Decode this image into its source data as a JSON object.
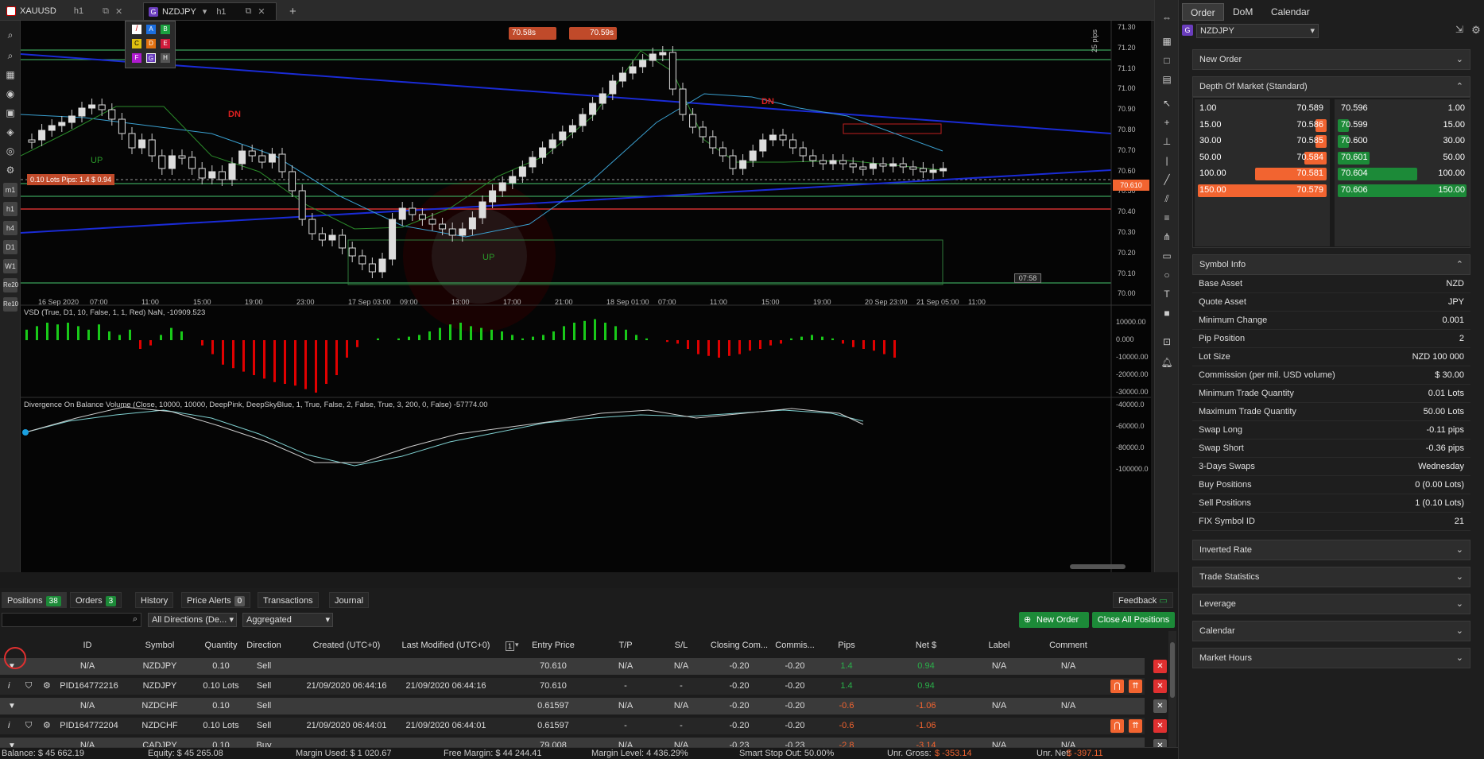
{
  "tabs": [
    {
      "label": "XAUUSD",
      "timeframe": "h1"
    },
    {
      "label": "NZDJPY",
      "timeframe": "h1"
    }
  ],
  "colors": {
    "up": "#19c919",
    "down": "#e00000",
    "buy": "#1c8a38",
    "sell": "#f26430",
    "accent": "#6a3dbd"
  },
  "chart": {
    "ask_box": "70.58s",
    "bid_box": "70.59s",
    "dn_label": "DN",
    "up_label": "UP",
    "position_line": "0.10 Lots  Pips: 1.4  $ 0.94",
    "pips_scale": "25 pips",
    "current_price": "70.610",
    "timer": "07:58",
    "price_ticks": [
      "71.30",
      "71.20",
      "71.10",
      "71.00",
      "70.90",
      "70.80",
      "70.70",
      "70.60",
      "70.50",
      "70.40",
      "70.30",
      "70.20",
      "70.10",
      "70.00"
    ],
    "time_ticks": [
      "16 Sep 2020",
      "07:00",
      "11:00",
      "15:00",
      "19:00",
      "23:00",
      "17 Sep 03:00",
      "09:00",
      "13:00",
      "17:00",
      "21:00",
      "18 Sep 01:00",
      "07:00",
      "11:00",
      "15:00",
      "19:00",
      "20 Sep 23:00",
      "21 Sep 05:00",
      "11:00"
    ],
    "vsd_label": "VSD (True, D1, 10, False, 1, 1, Red) NaN, -10909.523",
    "vsd_ticks": [
      "10000.00",
      "0.000",
      "-10000.00",
      "-20000.00",
      "-30000.00"
    ],
    "dobv_label": "Divergence On Balance Volume (Close, 10000, 10000, DeepPink, DeepSkyBlue, 1, True, False, 2, False, True, 3, 200, 0, False) -57774.00",
    "dobv_ticks": [
      "-40000.0",
      "-60000.0",
      "-80000.0",
      "-100000.0"
    ],
    "palette": [
      "A",
      "B",
      "C",
      "D",
      "E",
      "F",
      "G",
      "H"
    ],
    "left_tools": [
      "m1",
      "h1",
      "h4",
      "D1",
      "W1",
      "Re20",
      "Re10"
    ]
  },
  "right_panel": {
    "tabs": [
      "Order",
      "DoM",
      "Calendar"
    ],
    "symbol": "NZDJPY",
    "new_order": "New Order",
    "dom_title": "Depth Of Market (Standard)",
    "dom_bids": [
      {
        "qty": "1.00",
        "price": "70.589"
      },
      {
        "qty": "15.00",
        "price": "70.586"
      },
      {
        "qty": "30.00",
        "price": "70.585"
      },
      {
        "qty": "50.00",
        "price": "70.584"
      },
      {
        "qty": "100.00",
        "price": "70.581"
      },
      {
        "qty": "150.00",
        "price": "70.579"
      }
    ],
    "dom_asks": [
      {
        "qty": "1.00",
        "price": "70.596"
      },
      {
        "qty": "15.00",
        "price": "70.599"
      },
      {
        "qty": "30.00",
        "price": "70.600"
      },
      {
        "qty": "50.00",
        "price": "70.601"
      },
      {
        "qty": "100.00",
        "price": "70.604"
      },
      {
        "qty": "150.00",
        "price": "70.606"
      }
    ],
    "symbol_info_title": "Symbol Info",
    "symbol_info": [
      {
        "k": "Base Asset",
        "v": "NZD"
      },
      {
        "k": "Quote Asset",
        "v": "JPY"
      },
      {
        "k": "Minimum Change",
        "v": "0.001"
      },
      {
        "k": "Pip Position",
        "v": "2"
      },
      {
        "k": "Lot Size",
        "v": "NZD 100 000"
      },
      {
        "k": "Commission (per mil. USD volume)",
        "v": "$ 30.00"
      },
      {
        "k": "Minimum Trade Quantity",
        "v": "0.01 Lots"
      },
      {
        "k": "Maximum Trade Quantity",
        "v": "50.00 Lots"
      },
      {
        "k": "Swap Long",
        "v": "-0.11 pips"
      },
      {
        "k": "Swap Short",
        "v": "-0.36 pips"
      },
      {
        "k": "3-Days Swaps",
        "v": "Wednesday"
      },
      {
        "k": "Buy Positions",
        "v": "0 (0.00 Lots)"
      },
      {
        "k": "Sell Positions",
        "v": "1 (0.10 Lots)"
      },
      {
        "k": "FIX Symbol ID",
        "v": "21"
      }
    ],
    "collapsed_sections": [
      "Inverted Rate",
      "Trade Statistics",
      "Leverage",
      "Calendar",
      "Market Hours"
    ]
  },
  "bottom": {
    "tabs": [
      {
        "label": "Positions",
        "badge": "38"
      },
      {
        "label": "Orders",
        "badge": "3"
      },
      {
        "label": "History",
        "badge": ""
      },
      {
        "label": "Price Alerts",
        "badge": "0"
      },
      {
        "label": "Transactions",
        "badge": ""
      },
      {
        "label": "Journal",
        "badge": ""
      }
    ],
    "feedback": "Feedback",
    "direction_filter": "All Directions (De...",
    "grouping": "Aggregated",
    "new_order_btn": "New Order",
    "close_all_btn": "Close All Positions",
    "columns": [
      "ID",
      "Symbol",
      "Quantity",
      "Direction",
      "Created (UTC+0)",
      "Last Modified (UTC+0)",
      "Entry Price",
      "T/P",
      "S/L",
      "Closing Com...",
      "Commis...",
      "Pips",
      "Net $",
      "Label",
      "Comment"
    ],
    "sort_badge": "1",
    "rows": [
      {
        "type": "group",
        "id": "N/A",
        "symbol": "NZDJPY",
        "qty": "0.10",
        "dir": "Sell",
        "created": "",
        "modified": "",
        "entry": "70.610",
        "tp": "N/A",
        "sl": "N/A",
        "closing": "-0.20",
        "comm": "-0.20",
        "pips": "1.4",
        "net": "0.94",
        "label": "N/A",
        "comment": "N/A",
        "pos": true
      },
      {
        "type": "detail",
        "id": "PID164772216",
        "symbol": "NZDJPY",
        "qty": "0.10 Lots",
        "dir": "Sell",
        "created": "21/09/2020 06:44:16",
        "modified": "21/09/2020 06:44:16",
        "entry": "70.610",
        "tp": "-",
        "sl": "-",
        "closing": "-0.20",
        "comm": "-0.20",
        "pips": "1.4",
        "net": "0.94",
        "label": "",
        "comment": "",
        "pos": true
      },
      {
        "type": "group",
        "id": "N/A",
        "symbol": "NZDCHF",
        "qty": "0.10",
        "dir": "Sell",
        "created": "",
        "modified": "",
        "entry": "0.61597",
        "tp": "N/A",
        "sl": "N/A",
        "closing": "-0.20",
        "comm": "-0.20",
        "pips": "-0.6",
        "net": "-1.06",
        "label": "N/A",
        "comment": "N/A",
        "pos": false
      },
      {
        "type": "detail",
        "id": "PID164772204",
        "symbol": "NZDCHF",
        "qty": "0.10 Lots",
        "dir": "Sell",
        "created": "21/09/2020 06:44:01",
        "modified": "21/09/2020 06:44:01",
        "entry": "0.61597",
        "tp": "-",
        "sl": "-",
        "closing": "-0.20",
        "comm": "-0.20",
        "pips": "-0.6",
        "net": "-1.06",
        "label": "",
        "comment": "",
        "pos": false
      },
      {
        "type": "group",
        "id": "N/A",
        "symbol": "CADJPY",
        "qty": "0.10",
        "dir": "Buy",
        "created": "",
        "modified": "",
        "entry": "79.008",
        "tp": "N/A",
        "sl": "N/A",
        "closing": "-0.23",
        "comm": "-0.23",
        "pips": "-2.8",
        "net": "-3.14",
        "label": "N/A",
        "comment": "N/A",
        "pos": false
      }
    ]
  },
  "status": {
    "balance": "Balance: $ 45 662.19",
    "equity": "Equity: $ 45 265.08",
    "margin_used": "Margin Used: $ 1 020.67",
    "free_margin": "Free Margin: $ 44 244.41",
    "margin_level": "Margin Level: 4 436.29%",
    "smart_stop": "Smart Stop Out: 50.00%",
    "unr_gross_label": "Unr. Gross:",
    "unr_gross": "$ -353.14",
    "unr_net_label": "Unr. Net:",
    "unr_net": "$ -397.11"
  }
}
